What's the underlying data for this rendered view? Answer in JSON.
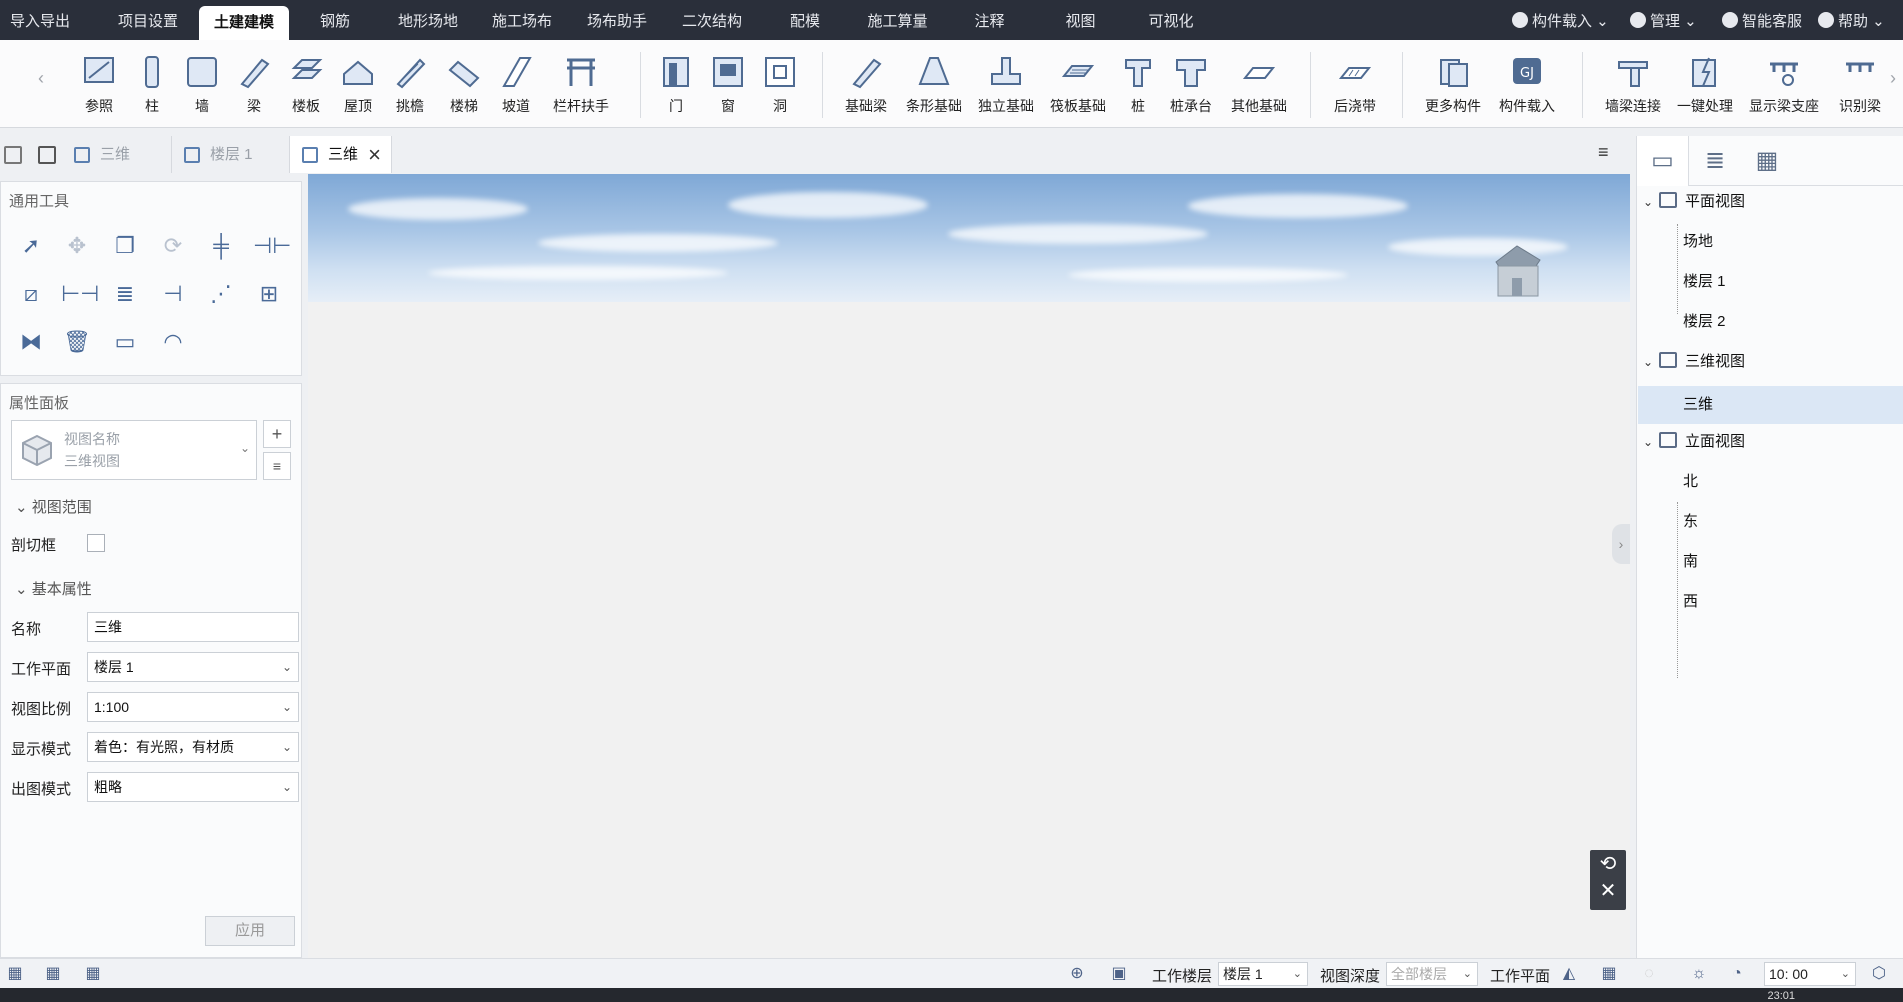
{
  "menu": {
    "tabs": [
      "导入导出",
      "项目设置",
      "土建建模",
      "钢筋",
      "地形场地",
      "施工场布",
      "场布助手",
      "二次结构",
      "配模",
      "施工算量",
      "注释",
      "视图",
      "可视化"
    ],
    "active_tab": "土建建模",
    "right_items": [
      "构件载入",
      "管理",
      "智能客服",
      "帮助"
    ]
  },
  "ribbon": {
    "tools": [
      "参照",
      "柱",
      "墙",
      "梁",
      "楼板",
      "屋顶",
      "挑檐",
      "楼梯",
      "坡道",
      "栏杆扶手",
      "门",
      "窗",
      "洞",
      "基础梁",
      "条形基础",
      "独立基础",
      "筏板基础",
      "桩",
      "桩承台",
      "其他基础",
      "后浇带",
      "更多构件",
      "构件载入",
      "墙梁连接",
      "一键处理",
      "显示梁支座",
      "识别梁"
    ]
  },
  "doctabs": {
    "tabs": [
      "三维",
      "楼层 1",
      "三维"
    ],
    "active_index": 2
  },
  "general_tools": {
    "title": "通用工具"
  },
  "property_panel": {
    "title": "属性面板",
    "view_name_label": "视图名称",
    "view_type": "三维视图",
    "section_view_range": "视图范围",
    "crop_box_label": "剖切框",
    "section_basic": "基本属性",
    "rows": [
      {
        "label": "名称",
        "value": "三维"
      },
      {
        "label": "工作平面",
        "value": "楼层 1"
      },
      {
        "label": "视图比例",
        "value": "1:100"
      },
      {
        "label": "显示模式",
        "value": "着色：有光照，有材质"
      },
      {
        "label": "出图模式",
        "value": "粗略"
      }
    ],
    "apply_label": "应用"
  },
  "project_tree": {
    "groups": [
      {
        "label": "平面视图",
        "children": [
          "场地",
          "楼层 1",
          "楼层 2"
        ]
      },
      {
        "label": "三维视图",
        "children": [
          "三维"
        ]
      },
      {
        "label": "立面视图",
        "children": [
          "北",
          "东",
          "南",
          "西"
        ]
      }
    ],
    "selected": "三维"
  },
  "statusbar": {
    "work_floor_label": "工作楼层",
    "work_floor_value": "楼层 1",
    "view_depth_label": "视图深度",
    "view_depth_value": "全部楼层",
    "work_plane_label": "工作平面",
    "time_value": "10: 00"
  },
  "taskbar": {
    "clock": "23:01"
  }
}
